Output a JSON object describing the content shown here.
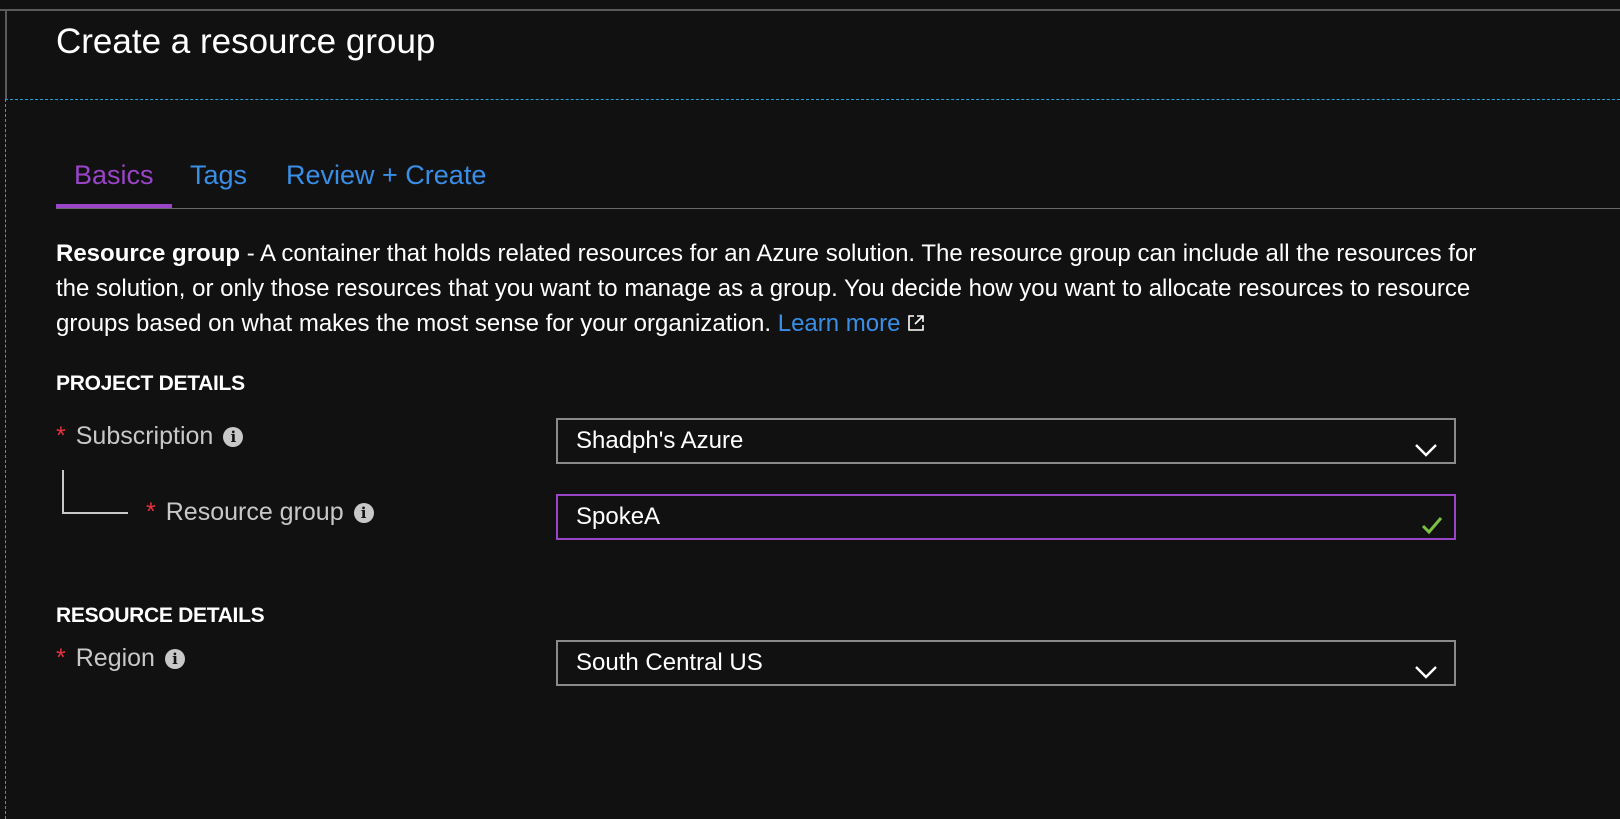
{
  "page": {
    "title": "Create a resource group"
  },
  "tabs": [
    {
      "label": "Basics",
      "active": true
    },
    {
      "label": "Tags",
      "active": false
    },
    {
      "label": "Review + Create",
      "active": false
    }
  ],
  "description": {
    "term": "Resource group",
    "text": " - A container that holds related resources for an Azure solution. The resource group can include all the resources for the solution, or only those resources that you want to manage as a group. You decide how you want to allocate resources to resource groups based on what makes the most sense for your organization. ",
    "link": "Learn more"
  },
  "project_details": {
    "heading": "PROJECT DETAILS",
    "subscription": {
      "required_mark": "*",
      "label": "Subscription",
      "info": "i",
      "value": "Shadph's Azure"
    },
    "resource_group": {
      "required_mark": "*",
      "label": "Resource group",
      "info": "i",
      "value": "SpokeA",
      "valid": true
    }
  },
  "resource_details": {
    "heading": "RESOURCE DETAILS",
    "region": {
      "required_mark": "*",
      "label": "Region",
      "info": "i",
      "value": "South Central US"
    }
  },
  "colors": {
    "background": "#111112",
    "accent_active_tab": "#9a44c8",
    "link": "#3a8ee6",
    "required": "#e8333f",
    "valid_check": "#7bc142"
  },
  "icons": {
    "external_link": "external-link-icon",
    "dropdown": "chevron-down-icon",
    "valid": "checkmark-icon",
    "info": "info-icon"
  }
}
